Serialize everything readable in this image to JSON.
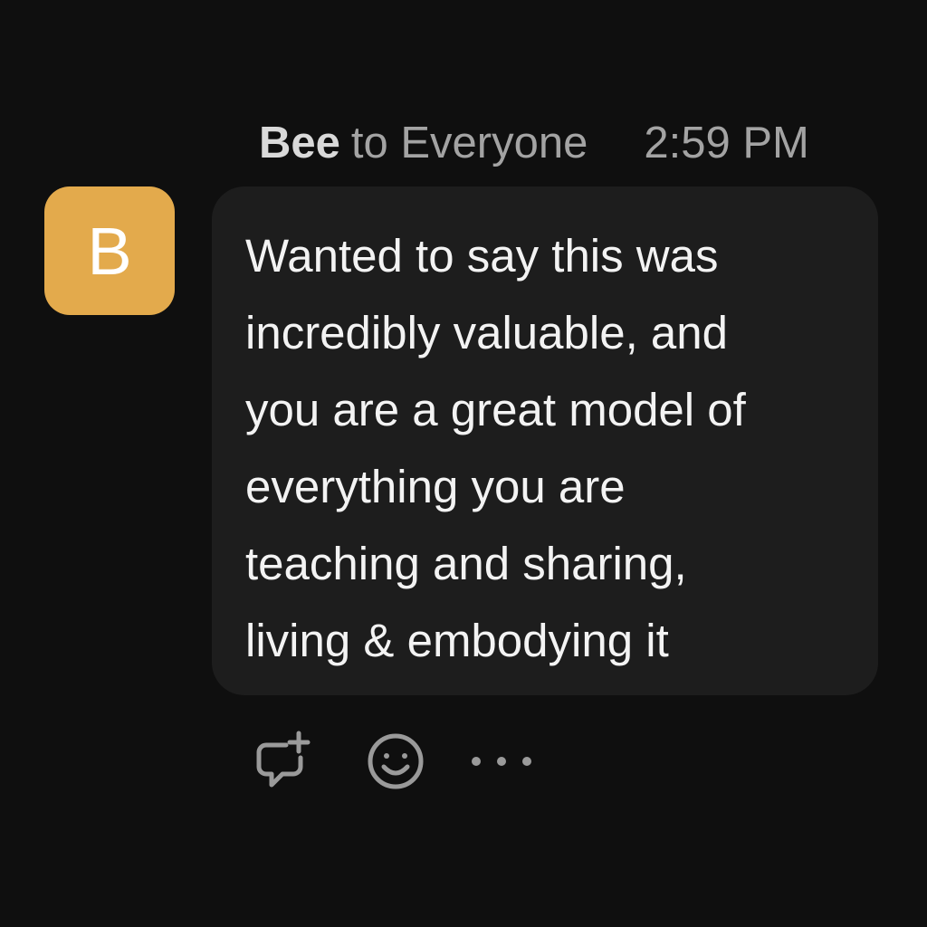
{
  "message": {
    "sender": "Bee",
    "recipient": "to Everyone",
    "time": "2:59 PM",
    "avatar_letter": "B",
    "text": "Wanted to say this was\nincredibly valuable, and\nyou are a great model of\neverything you are\nteaching and sharing,\nliving & embodying it"
  },
  "actions": [
    {
      "icon": "reply-in-thread-icon"
    },
    {
      "icon": "add-reaction-icon"
    },
    {
      "icon": "more-options-icon"
    }
  ],
  "colors": {
    "background": "#0f0f0f",
    "bubble": "#1d1d1d",
    "avatar": "#e3aa4c",
    "text": "#f3f3f3",
    "muted": "#a3a3a3",
    "icon": "#9a9a9a"
  }
}
